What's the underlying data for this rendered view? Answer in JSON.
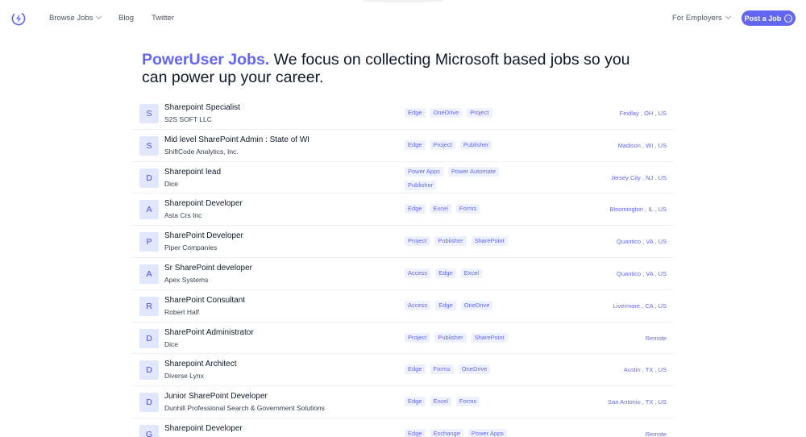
{
  "nav": {
    "browse_jobs": "Browse Jobs",
    "blog": "Blog",
    "twitter": "Twitter",
    "for_employers": "For Employers",
    "post_job": "Post a Job"
  },
  "hero": {
    "brand": "PowerUser Jobs.",
    "tagline": "We focus on collecting Microsoft based jobs so you can power up your career."
  },
  "colors": {
    "accent": "#6366f1",
    "tag_bg": "#eef2ff",
    "avatar_bg": "#e0e7ff"
  },
  "jobs": [
    {
      "letter": "S",
      "title": "Sharepoint Specialist",
      "company": "S2S SOFT LLC",
      "tags": [
        "Edge",
        "OneDrive",
        "Project"
      ],
      "location": "Findlay , OH , US"
    },
    {
      "letter": "S",
      "title": "Mid level SharePoint Admin : State of WI",
      "company": "ShiftCode Analytics, Inc.",
      "tags": [
        "Edge",
        "Project",
        "Publisher"
      ],
      "location": "Madison , WI , US"
    },
    {
      "letter": "D",
      "title": "Sharepoint lead",
      "company": "Dice",
      "tags": [
        "Power Apps",
        "Power Automate",
        "Publisher"
      ],
      "location": "Jersey City , NJ , US"
    },
    {
      "letter": "A",
      "title": "Sharepoint Developer",
      "company": "Asta Crs Inc",
      "tags": [
        "Edge",
        "Excel",
        "Forms"
      ],
      "location": "Bloomington , IL , US"
    },
    {
      "letter": "P",
      "title": "SharePoint Developer",
      "company": "Piper Companies",
      "tags": [
        "Project",
        "Publisher",
        "SharePoint"
      ],
      "location": "Quantico , VA , US"
    },
    {
      "letter": "A",
      "title": "Sr SharePoint developer",
      "company": "Apex Systems",
      "tags": [
        "Access",
        "Edge",
        "Excel"
      ],
      "location": "Quantico , VA , US"
    },
    {
      "letter": "R",
      "title": "SharePoint Consultant",
      "company": "Robert Half",
      "tags": [
        "Access",
        "Edge",
        "OneDrive"
      ],
      "location": "Livermore , CA , US"
    },
    {
      "letter": "D",
      "title": "SharePoint Administrator",
      "company": "Dice",
      "tags": [
        "Project",
        "Publisher",
        "SharePoint"
      ],
      "location": "Remote"
    },
    {
      "letter": "D",
      "title": "Sharepoint Architect",
      "company": "Diverse Lynx",
      "tags": [
        "Edge",
        "Forms",
        "OneDrive"
      ],
      "location": "Austin , TX , US"
    },
    {
      "letter": "D",
      "title": "Junior SharePoint Developer",
      "company": "Dunhill Professional Search & Government Solutions",
      "tags": [
        "Edge",
        "Excel",
        "Forms"
      ],
      "location": "San Antonio , TX , US"
    },
    {
      "letter": "G",
      "title": "Sharepoint Developer",
      "company": "",
      "tags": [
        "Edge",
        "Exchange",
        "Power Apps"
      ],
      "location": "Remote"
    }
  ]
}
